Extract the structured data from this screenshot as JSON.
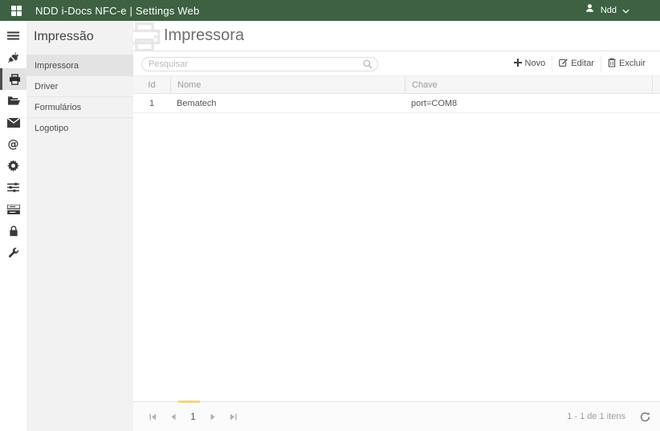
{
  "topbar": {
    "title": "NDD i-Docs NFC-e | Settings Web",
    "user_name": "Ndd",
    "color": "#3d6142",
    "icons": [
      "apps-grid-icon",
      "user-icon",
      "chevron-down-icon"
    ]
  },
  "rail": {
    "icons": [
      "menu-icon",
      "plug-icon",
      "printer-icon",
      "folder-open-icon",
      "mail-icon",
      "at-icon",
      "gear-icon",
      "sliders-icon",
      "server-icon",
      "lock-icon",
      "wrench-icon"
    ],
    "active_icon": "printer-icon"
  },
  "sidebar": {
    "heading": "Impressão",
    "items": [
      {
        "label": "Impressora",
        "active": true
      },
      {
        "label": "Driver",
        "active": false
      },
      {
        "label": "Formulários",
        "active": false
      },
      {
        "label": "Logotipo",
        "active": false
      }
    ]
  },
  "main": {
    "title": "Impressora",
    "watermark_icon": "printer-icon"
  },
  "toolbar": {
    "search_placeholder": "Pesquisar",
    "search_value": "",
    "buttons": [
      {
        "label": "Novo",
        "icon": "plus-icon"
      },
      {
        "label": "Editar",
        "icon": "edit-pencil-icon"
      },
      {
        "label": "Excluir",
        "icon": "trash-icon"
      }
    ]
  },
  "grid": {
    "columns": [
      "Id",
      "Nome",
      "Chave"
    ],
    "rows": [
      [
        "1",
        "Bematech",
        "port=COM8"
      ]
    ]
  },
  "pager": {
    "current_page": "1",
    "info": "1 - 1 de 1 itens",
    "indicator_color": "#f0d683",
    "icons": [
      "first-page-icon",
      "prev-page-icon",
      "next-page-icon",
      "last-page-icon",
      "refresh-icon"
    ]
  }
}
